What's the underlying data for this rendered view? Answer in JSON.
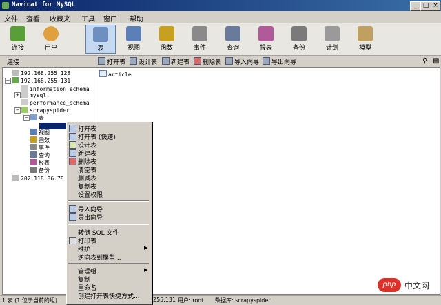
{
  "window": {
    "title": "Navicat for MySQL",
    "minimize": "_",
    "maximize": "□",
    "close": "×"
  },
  "menu": [
    "文件",
    "查看",
    "收藏夹",
    "工具",
    "窗口",
    "帮助"
  ],
  "toolbar": [
    {
      "label": "连接",
      "icon": "connection-icon",
      "color": "#5a9e3a"
    },
    {
      "label": "用户",
      "icon": "user-icon",
      "color": "#e0a040"
    },
    {
      "label": "表",
      "icon": "table-icon",
      "color": "#6f8fc0",
      "active": true
    },
    {
      "label": "视图",
      "icon": "view-icon",
      "color": "#5c7fb8"
    },
    {
      "label": "函数",
      "icon": "function-icon",
      "color": "#c8a020"
    },
    {
      "label": "事件",
      "icon": "event-icon",
      "color": "#8a8a8a"
    },
    {
      "label": "查询",
      "icon": "query-icon",
      "color": "#6a7a9a"
    },
    {
      "label": "报表",
      "icon": "report-icon",
      "color": "#b05a9a"
    },
    {
      "label": "备份",
      "icon": "backup-icon",
      "color": "#7a7a7a"
    },
    {
      "label": "计划",
      "icon": "schedule-icon",
      "color": "#9a9a9a"
    },
    {
      "label": "模型",
      "icon": "model-icon",
      "color": "#c0a060"
    }
  ],
  "subbar": {
    "connection_label": "连接",
    "buttons": [
      "打开表",
      "设计表",
      "新建表",
      "删除表",
      "导入向导",
      "导出向导"
    ],
    "search_icon": "search-icon",
    "list_icon": "list-view-icon"
  },
  "tree": {
    "nodes": [
      {
        "label": "192.168.255.128",
        "icon": "server-icon"
      },
      {
        "label": "192.168.255.131",
        "icon": "server-icon",
        "expanded": true
      },
      {
        "label": "information_schema",
        "icon": "database-icon"
      },
      {
        "label": "mysql",
        "icon": "database-icon"
      },
      {
        "label": "performance_schema",
        "icon": "database-icon"
      },
      {
        "label": "scrapyspider",
        "icon": "database-icon",
        "expanded": true
      },
      {
        "label": "表",
        "icon": "tables-folder-icon",
        "expanded": true
      },
      {
        "label": "视图",
        "icon": "view-icon"
      },
      {
        "label": "函数",
        "icon": "function-icon"
      },
      {
        "label": "事件",
        "icon": "event-icon"
      },
      {
        "label": "查询",
        "icon": "query-icon"
      },
      {
        "label": "报表",
        "icon": "report-icon"
      },
      {
        "label": "备份",
        "icon": "backup-icon"
      },
      {
        "label": "202.118.86.78",
        "icon": "server-icon"
      }
    ]
  },
  "content": {
    "items": [
      "article"
    ]
  },
  "context_menu": [
    {
      "label": "打开表",
      "icon": true
    },
    {
      "label": "打开表 (快速)",
      "icon": true
    },
    {
      "label": "设计表",
      "icon": true
    },
    {
      "label": "新建表",
      "icon": true
    },
    {
      "label": "删除表",
      "icon": true
    },
    {
      "label": "清空表"
    },
    {
      "label": "删减表"
    },
    {
      "label": "复制表"
    },
    {
      "label": "设置权限"
    },
    {
      "label": "导入向导",
      "icon": true
    },
    {
      "label": "导出向导",
      "icon": true
    },
    {
      "label": "转储 SQL 文件"
    },
    {
      "label": "打印表",
      "icon": true
    },
    {
      "label": "维护",
      "submenu": true
    },
    {
      "label": "逆向表到模型..."
    },
    {
      "label": "管理组",
      "submenu": true
    },
    {
      "label": "复制"
    },
    {
      "label": "重命名"
    },
    {
      "label": "创建打开表快捷方式..."
    }
  ],
  "status": {
    "left": "1 表 (1 位于当前的组)",
    "host": "255.131",
    "user": "用户: root",
    "database": "数据库: scrapyspider"
  },
  "watermark": {
    "logo": "php",
    "text": "中文网"
  }
}
